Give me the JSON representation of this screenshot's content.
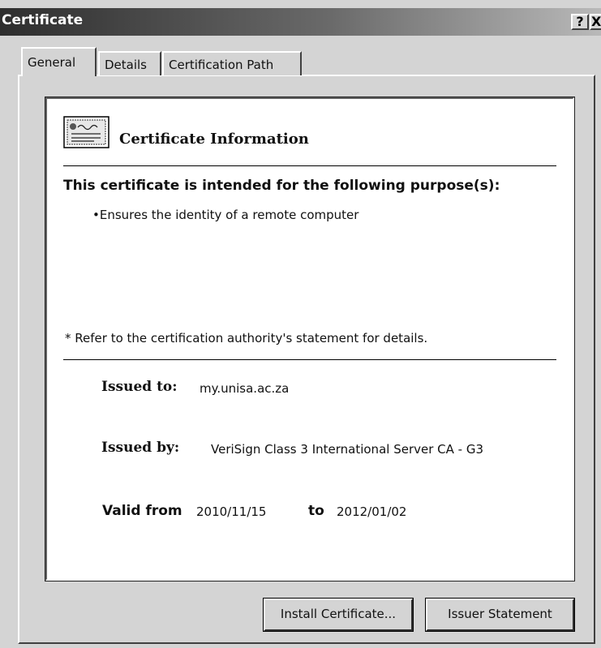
{
  "window": {
    "title": "Certificate",
    "help_button": "?",
    "close_button": "X"
  },
  "tabs": [
    {
      "label": "General",
      "active": true
    },
    {
      "label": "Details",
      "active": false
    },
    {
      "label": "Certification Path",
      "active": false
    }
  ],
  "info": {
    "heading": "Certificate Information",
    "purpose_heading": "This certificate is intended for the following purpose(s):",
    "purposes": [
      "•Ensures the identity of a remote computer"
    ],
    "refer_note": "* Refer to the certification authority's statement for details."
  },
  "details": {
    "issued_to_label": "Issued to:",
    "issued_to": "my.unisa.ac.za",
    "issued_by_label": "Issued by:",
    "issued_by": "VeriSign Class 3 International Server CA - G3",
    "valid_from_label": "Valid from",
    "valid_from": "2010/11/15",
    "to_label": "to",
    "valid_to": "2012/01/02"
  },
  "buttons": {
    "install": "Install Certificate...",
    "issuer_statement": "Issuer Statement"
  },
  "icons": {
    "certificate": "certificate-icon"
  }
}
